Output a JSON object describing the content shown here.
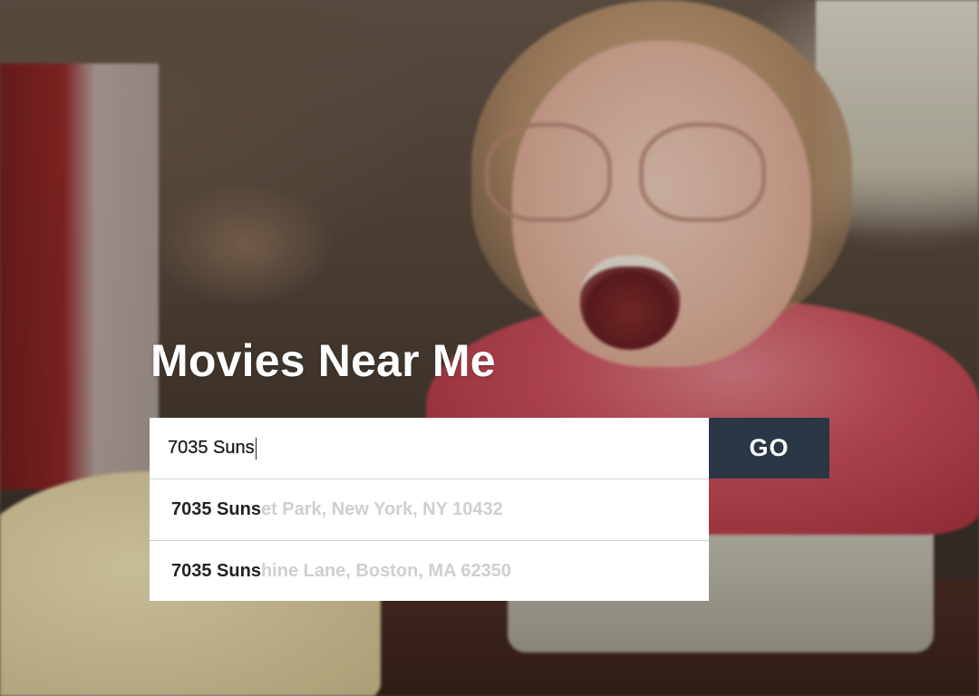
{
  "page": {
    "title": "Movies Near Me"
  },
  "search": {
    "value": "7035 Suns",
    "go_label": "GO"
  },
  "suggestions": [
    {
      "match": "7035 Suns",
      "rest": "et Park, New York, NY 10432"
    },
    {
      "match": "7035 Suns",
      "rest": "hine Lane, Boston, MA 62350"
    }
  ],
  "colors": {
    "go_button_bg": "#2b3645",
    "title_text": "#ffffff",
    "suggestion_match_text": "#222222",
    "suggestion_rest_text": "#cfcfcf"
  }
}
